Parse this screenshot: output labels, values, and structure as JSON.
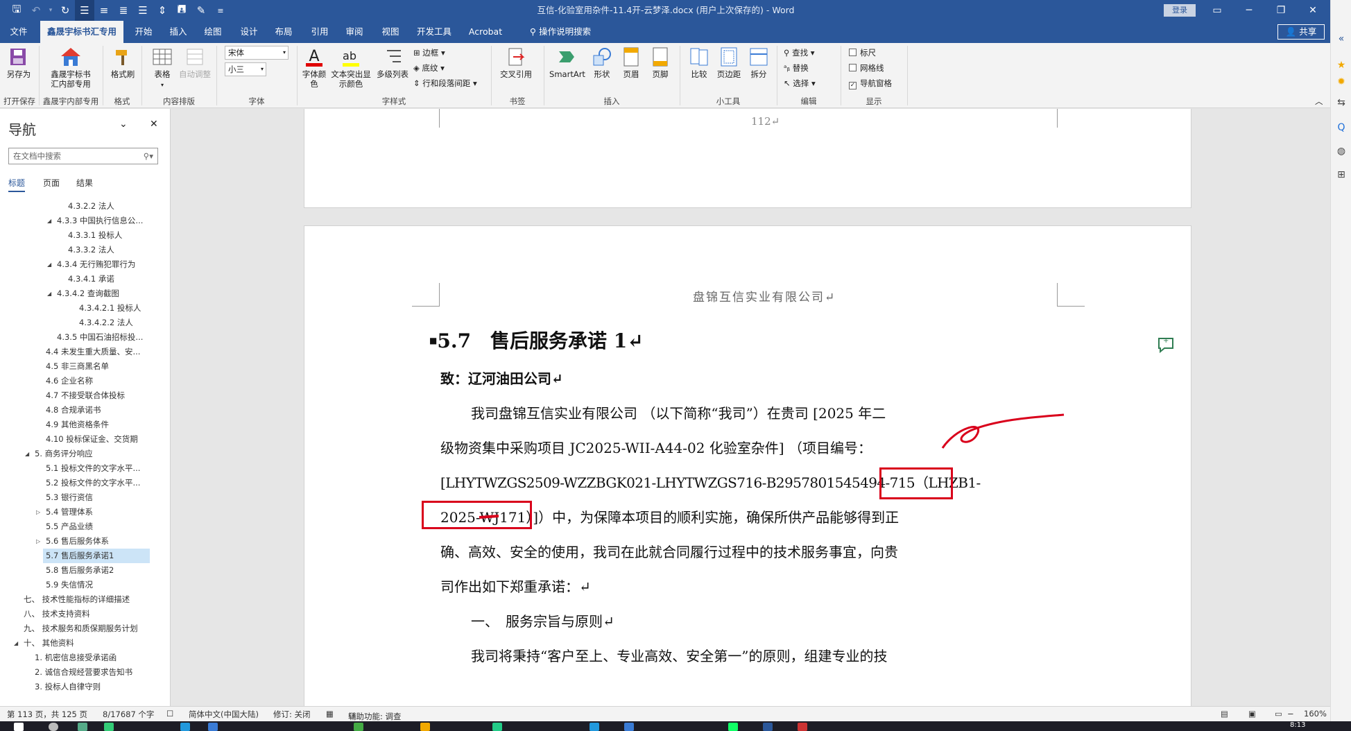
{
  "titlebar": {
    "title": "互信-化验室用杂件-11.4开-云梦泽.docx (用户上次保存的) - Word",
    "signin": "登录",
    "qat_more": "≡"
  },
  "tabs": [
    "文件",
    "鑫晟宇标书汇专用",
    "开始",
    "插入",
    "绘图",
    "设计",
    "布局",
    "引用",
    "审阅",
    "视图",
    "开发工具",
    "Acrobat",
    "操作说明搜索"
  ],
  "share": "共享",
  "ribbon": {
    "btn_saveas": "另存为",
    "lbl_openSave": "打开保存",
    "btn_xsy1": "鑫晟宇标书",
    "btn_xsy2": "汇内部专用",
    "lbl_xsy": "鑫晟宇内部专用",
    "btn_formatpainter": "格式刷",
    "lbl_format": "格式",
    "btn_table": "表格",
    "btn_autoadjust": "自动调整",
    "lbl_layout": "内容排版",
    "font_name": "宋体",
    "font_size": "小三",
    "lbl_font": "字体",
    "btn_fontcolor1": "字体颜",
    "btn_fontcolor2": "色",
    "btn_highlight1": "文本突出显",
    "btn_highlight2": "示颜色",
    "btn_multilist": "多级列表",
    "border": "边框",
    "shading": "底纹",
    "para_spacing": "行和段落间距",
    "lbl_style": "字样式",
    "btn_crossref": "交叉引用",
    "lbl_bookmark": "书签",
    "btn_smartart": "SmartArt",
    "btn_shapes": "形状",
    "btn_header": "页眉",
    "btn_footer": "页脚",
    "lbl_insert": "插入",
    "btn_compare": "比较",
    "btn_margins": "页边距",
    "btn_split": "拆分",
    "lbl_tools": "小工具",
    "find": "查找",
    "replace": "替换",
    "select": "选择",
    "lbl_edit": "编辑",
    "chk_ruler": "标尺",
    "chk_grid": "网格线",
    "chk_navpane": "导航窗格",
    "lbl_show": "显示"
  },
  "nav": {
    "title": "导航",
    "search_placeholder": "在文档中搜索",
    "tabs": [
      "标题",
      "页面",
      "结果"
    ],
    "items": [
      "4.3.2.2 法人",
      "4.3.3 中国执行信息公...",
      "4.3.3.1 投标人",
      "4.3.3.2 法人",
      "4.3.4 无行贿犯罪行为",
      "4.3.4.1 承诺",
      "4.3.4.2 查询截图",
      "4.3.4.2.1 投标人",
      "4.3.4.2.2 法人",
      "4.3.5 中国石油招标投...",
      "4.4 未发生重大质量、安...",
      "4.5 非三商黑名单",
      "4.6 企业名称",
      "4.7 不接受联合体投标",
      "4.8 合规承诺书",
      "4.9 其他资格条件",
      "4.10 投标保证金、交货期",
      "5. 商务评分响应",
      "5.1 投标文件的文字水平...",
      "5.2 投标文件的文字水平...",
      "5.3 银行资信",
      "5.4 管理体系",
      "5.5 产品业绩",
      "5.6 售后服务体系",
      "5.7 售后服务承诺1",
      "5.8 售后服务承诺2",
      "5.9 失信情况",
      "七、 技术性能指标的详细描述",
      "八、 技术支持资料",
      "九、 技术服务和质保期服务计划",
      "十、 其他资料",
      "1. 机密信息接受承诺函",
      "2. 诚信合规经营要求告知书",
      "3. 投标人自律守则"
    ]
  },
  "document": {
    "page_number": "112↵",
    "header_company": "盘锦互信实业有限公司↵",
    "heading": "5.7　售后服务承诺 1↵",
    "to_line": "致：辽河油田公司↵",
    "lines": [
      "我司盘锦互信实业有限公司 （以下简称“我司”）在贵司 [2025 年二",
      "级物资集中采购项目 JC2025-WII-A44-02 化验室杂件] （项目编号：",
      "[LHYTWZGS2509-WZZBGK021-LHYTWZGS716-B2957801545494-715（LHZB1-",
      "2025-WJ171）]）中，为保障本项目的顺利实施，确保所供产品能够得到正",
      "确、高效、安全的使用，我司在此就合同履行过程中的技术服务事宜，向贵",
      "司作出如下郑重承诺：↵"
    ],
    "section_one": "一、　服务宗旨与原则↵",
    "last_line": "我司将秉持“客户至上、专业高效、安全第一”的原则，组建专业的技"
  },
  "status": {
    "page": "第 113 页，共 125 页",
    "words": "8/17687 个字",
    "lang": "简体中文(中国大陆)",
    "revision": "修订: 关闭",
    "accessibility": "辅助功能: 调查",
    "zoom": "160%"
  },
  "taskbar": {
    "time": "8:13"
  },
  "colors": {
    "brand": "#2b579a",
    "annotation_red": "#d9001b"
  }
}
